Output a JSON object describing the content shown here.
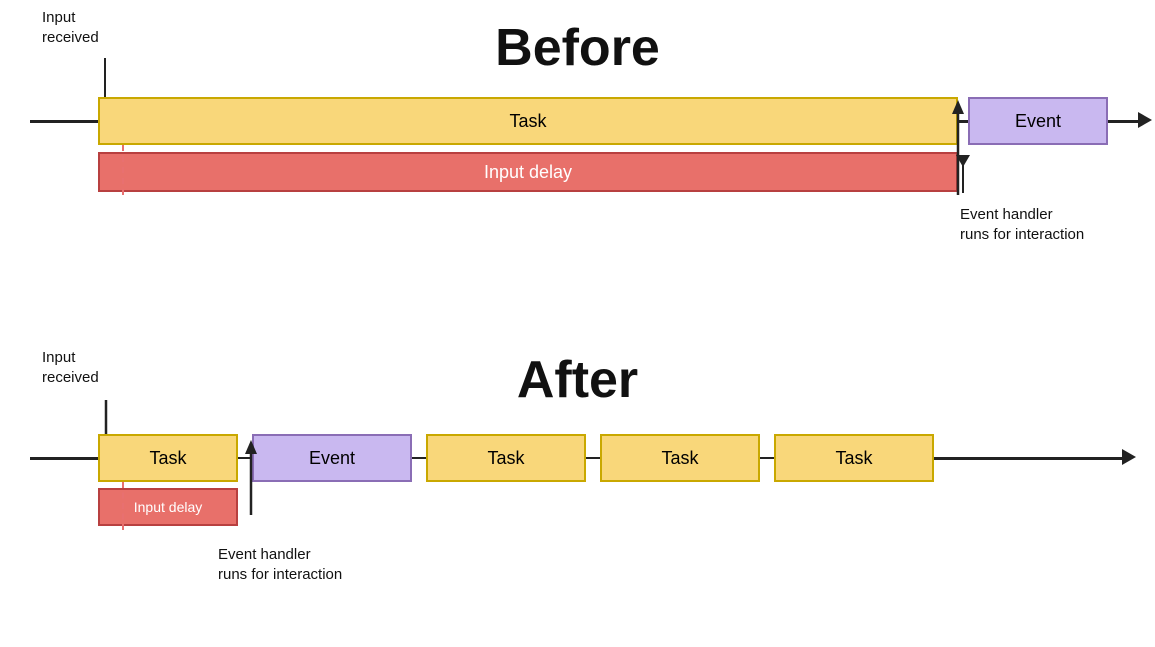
{
  "before": {
    "title": "Before",
    "input_received_label": "Input\nreceived",
    "task_label": "Task",
    "event_label": "Event",
    "input_delay_label": "Input delay",
    "event_handler_label": "Event handler\nruns for interaction"
  },
  "after": {
    "title": "After",
    "input_received_label": "Input\nreceived",
    "task_label": "Task",
    "event_label": "Event",
    "task2_label": "Task",
    "task3_label": "Task",
    "task4_label": "Task",
    "input_delay_label": "Input delay",
    "event_handler_label": "Event handler\nruns for interaction"
  }
}
